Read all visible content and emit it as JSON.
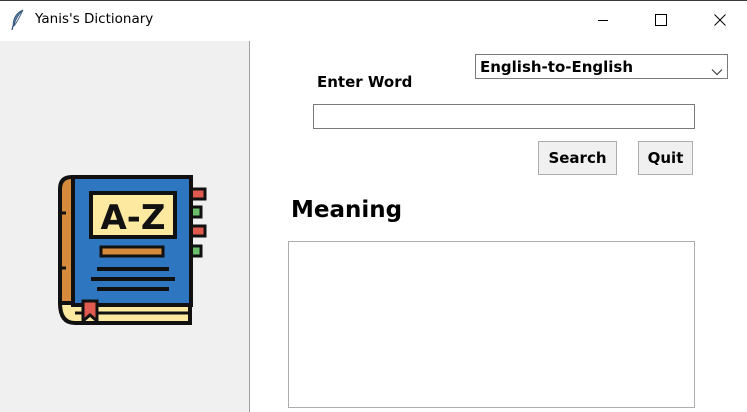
{
  "window": {
    "title": "Yanis's Dictionary",
    "icon": "feather-icon",
    "controls": [
      "minimize-icon",
      "maximize-icon",
      "close-icon"
    ]
  },
  "sidebar": {
    "image": "a-z-dictionary-book-icon",
    "image_text": "A-Z"
  },
  "form": {
    "language_select": {
      "selected": "English-to-English",
      "icon": "chevron-down-icon"
    },
    "enter_word_label": "Enter Word",
    "word_input_value": "",
    "search_label": "Search",
    "quit_label": "Quit",
    "meaning_label": "Meaning",
    "meaning_value": ""
  },
  "colors": {
    "panel_bg": "#f0f0f0",
    "book_blue": "#2f76c0",
    "book_spine": "#d58b3b",
    "label_yellow": "#fde9a0",
    "tab_red": "#e05a4f",
    "tab_green": "#6bbf6a"
  }
}
